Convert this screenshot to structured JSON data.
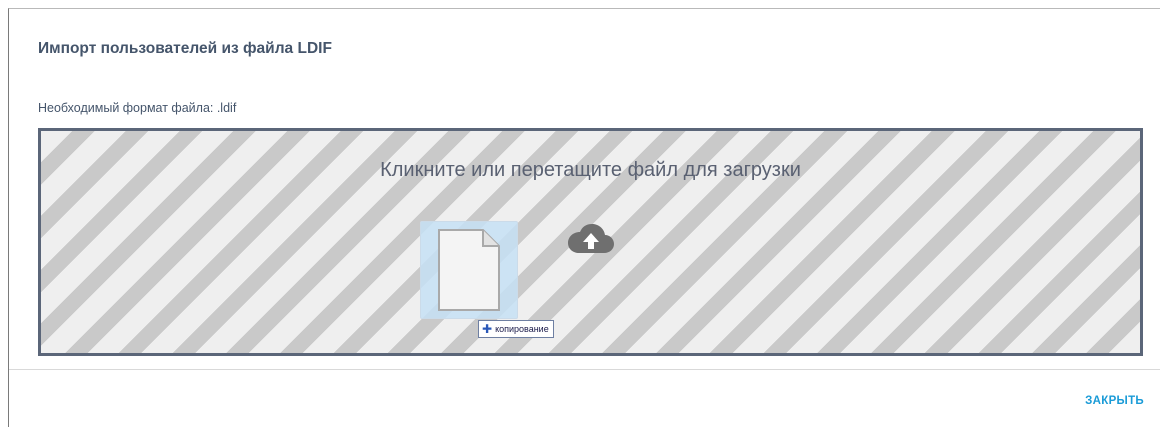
{
  "dialog": {
    "title": "Импорт пользователей из файла LDIF",
    "subtitle": "Необходимый формат файла: .ldif",
    "dropzone_text": "Кликните или перетащите файл для загрузки",
    "drag_badge_label": "копирование",
    "close_label": "ЗАКРЫТЬ"
  },
  "icons": {
    "upload": "cloud-upload-icon",
    "file": "file-icon",
    "plus": "plus-icon"
  },
  "colors": {
    "title": "#45556b",
    "accent": "#1a9bd7",
    "dropzone_border": "#5b6679"
  }
}
